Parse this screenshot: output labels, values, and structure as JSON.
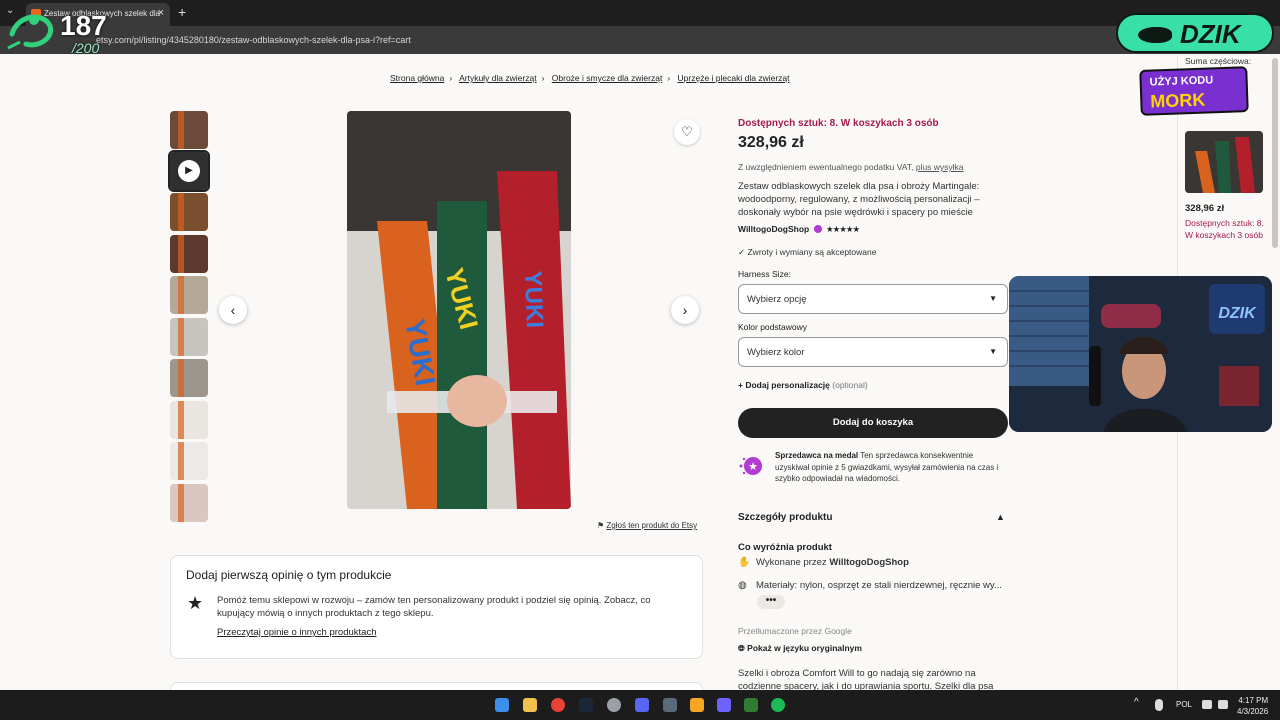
{
  "browser": {
    "tab_title": "Zestaw odblaskowych szelek dla",
    "tab_close": "×",
    "new_tab": "+",
    "url": "etsy.com/pl/listing/4345280180/zestaw-odblaskowych-szelek-dla-psa-i?ref=cart"
  },
  "overlay": {
    "counter_value": "187",
    "counter_total": "/200",
    "brand": "DZIK",
    "promo_line1": "UŻYJ KODU",
    "promo_line2": "MORK"
  },
  "breadcrumb": [
    "Strona główna",
    "Artykuły dla zwierząt",
    "Obroże i smycze dla zwierząt",
    "Uprzęże i plecaki dla zwierząt"
  ],
  "gallery": {
    "prev": "‹",
    "next": "›",
    "report": "Zgłoś ten produkt do Etsy",
    "thumb_colors": [
      "#6b4a3a",
      "#2f2f2f",
      "#7a4f30",
      "#5c3a2e",
      "#b5a898",
      "#c8c4bf",
      "#9c968d",
      "#e9e6e2",
      "#eceae6",
      "#d8c8c0"
    ],
    "image_text_left": "YUKI",
    "image_text_mid": "YUKI",
    "image_text_right": "YUKI"
  },
  "product": {
    "stock": "Dostępnych sztuk: 8. W koszykach 3 osób",
    "price": "328,96 zł",
    "vat_prefix": "Z uwzględnieniem ewentualnego podatku VAT, ",
    "vat_link": "plus wysyłka",
    "description": "Zestaw odblaskowych szelek dla psa i obroży Martingale: wodoodporny, regulowany, z możliwością personalizacji – doskonały wybór na psie wędrówki i spacery po mieście",
    "shop_name": "WilltogoDogShop",
    "shop_stars": "★★★★★",
    "returns": "Zwroty i wymiany są akceptowane",
    "size_label": "Harness Size:",
    "size_placeholder": "Wybierz opcję",
    "color_label": "Kolor podstawowy",
    "color_placeholder": "Wybierz kolor",
    "personal_label": "Dodaj personalizację",
    "personal_optional": "(optional)",
    "add_to_cart": "Dodaj do koszyka",
    "medal_title": "Sprzedawca na medal",
    "medal_text": " Ten sprzedawca konsekwentnie uzyskiwał opinie z 5 gwiazdkami, wysyłał zamówienia na czas i szybko odpowiadał na wiadomości."
  },
  "details": {
    "heading": "Szczegóły produktu",
    "highlight_heading": "Co wyróżnia produkt",
    "made_by_prefix": "Wykonane przez ",
    "made_by_shop": "WilltogoDogShop",
    "materials": "Materiały: nylon, osprzęt ze stali nierdzewnej, ręcznie wy...",
    "more": "•••",
    "translated": "Przetłumaczone przez Google",
    "show_original": "Pokaż w języku oryginalnym",
    "body": "Szelki i obroża Comfort Will to go nadają się zarówno na codzienne spacery, jak i do uprawiania sportu. Szelki dla psa"
  },
  "review": {
    "heading": "Dodaj pierwszą opinię o tym produkcie",
    "text": "Pomóż temu sklepowi w rozwoju – zamów ten personalizowany produkt i podziel się opinią. Zobacz, co kupujący mówią o innych produktach z tego sklepu.",
    "link": "Przeczytaj opinie o innych produktach"
  },
  "cart_sidebar": {
    "subtotal": "Suma częściowa:",
    "price": "328,96 zł",
    "stock": "Dostępnych sztuk: 8. W koszykach 3 osób"
  },
  "taskbar": {
    "lang": "POL",
    "time": "4:17 PM",
    "date": "4/3/2026",
    "tray_arrow": "^"
  },
  "colors": {
    "stock_red": "#a61a4a",
    "cart_button": "#222222",
    "overlay_green": "#38e0a8",
    "promo_purple": "#7a2fd0"
  }
}
